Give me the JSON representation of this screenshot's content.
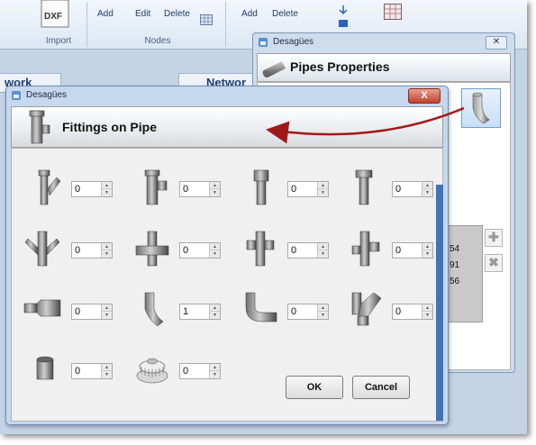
{
  "ribbon": {
    "import_group": {
      "label": "Import",
      "dxf_label": "DXF"
    },
    "nodes_group": {
      "label": "Nodes",
      "add": "Add",
      "edit": "Edit",
      "delete": "Delete"
    },
    "second_group": {
      "add": "Add",
      "delete": "Delete"
    }
  },
  "workspace": {
    "tab_left": "work",
    "tab_right": "Networ"
  },
  "back_dialog": {
    "title": "Desagües",
    "close": "✕",
    "header_title": "Pipes Properties",
    "list_values": [
      "54",
      "91",
      "56"
    ],
    "add_button": "✚",
    "remove_button": "✖"
  },
  "front_dialog": {
    "title": "Desagües",
    "close": "X",
    "header_title": "Fittings on  Pipe",
    "fittings": [
      {
        "icon": "y-branch-icon",
        "value": "0"
      },
      {
        "icon": "tee-branch-icon",
        "value": "0"
      },
      {
        "icon": "straight-coupling-icon",
        "value": "0"
      },
      {
        "icon": "socket-pipe-icon",
        "value": "0"
      },
      {
        "icon": "double-y-branch-icon",
        "value": "0"
      },
      {
        "icon": "cross-branch-icon",
        "value": "0"
      },
      {
        "icon": "double-tee-icon",
        "value": "0"
      },
      {
        "icon": "corner-tee-icon",
        "value": "0"
      },
      {
        "icon": "reducer-icon",
        "value": "0"
      },
      {
        "icon": "bend-45-icon",
        "value": "1"
      },
      {
        "icon": "bend-90-icon",
        "value": "0"
      },
      {
        "icon": "y-junction-icon",
        "value": "0"
      },
      {
        "icon": "end-cap-icon",
        "value": "0"
      },
      {
        "icon": "floor-drain-icon",
        "value": "0"
      }
    ],
    "ok": "OK",
    "cancel": "Cancel"
  },
  "colors": {
    "arrow": "#a01919",
    "title_bar": "#c6d8ee",
    "scrollbar": "#3f74b8"
  }
}
